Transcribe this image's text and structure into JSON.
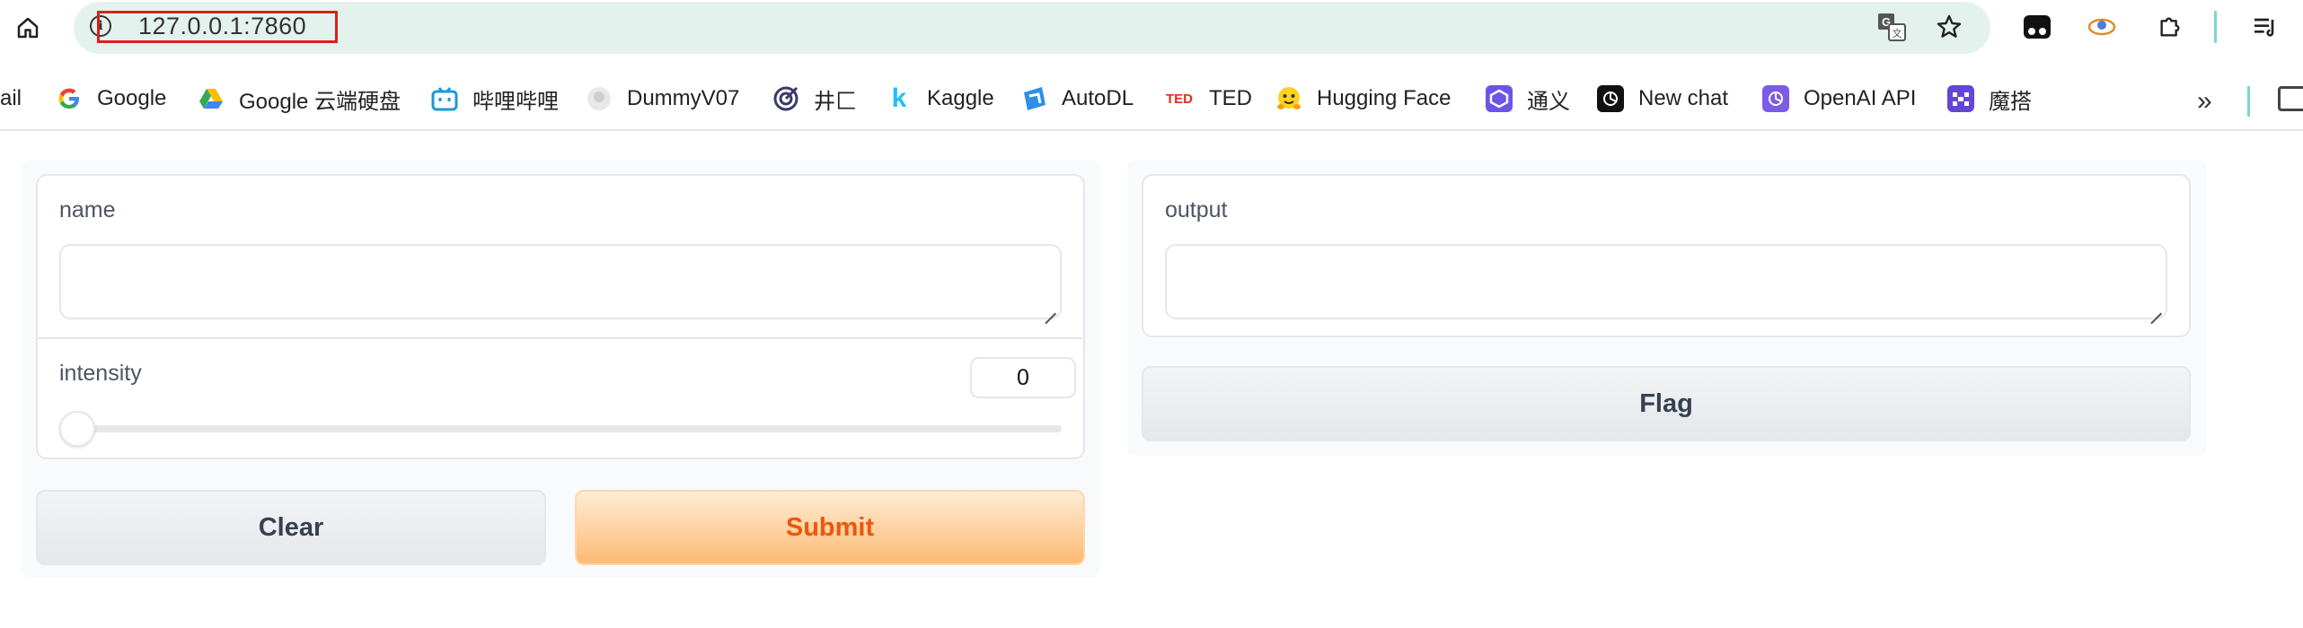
{
  "browser": {
    "url": "127.0.0.1:7860",
    "colors": {
      "omnibox_bg": "#e4f2ee",
      "url_highlight": "#d9201b"
    }
  },
  "bookmarks": [
    {
      "label": "ail",
      "icon": "none"
    },
    {
      "label": "Google",
      "icon": "google-icon"
    },
    {
      "label": "Google 云端硬盘",
      "icon": "google-drive-icon"
    },
    {
      "label": "哔哩哔哩",
      "icon": "bilibili-icon"
    },
    {
      "label": "DummyV07",
      "icon": "github-icon"
    },
    {
      "label": "井匚",
      "icon": "target-icon"
    },
    {
      "label": "Kaggle",
      "icon": "kaggle-icon"
    },
    {
      "label": "AutoDL",
      "icon": "autodl-icon"
    },
    {
      "label": "TED",
      "icon": "ted-icon"
    },
    {
      "label": "Hugging Face",
      "icon": "hugging-face-icon"
    },
    {
      "label": "通义",
      "icon": "tongyi-icon"
    },
    {
      "label": "New chat",
      "icon": "openai-icon"
    },
    {
      "label": "OpenAI API",
      "icon": "openai-api-icon"
    },
    {
      "label": "魔搭",
      "icon": "modelscope-icon"
    }
  ],
  "app": {
    "inputs": {
      "name_label": "name",
      "name_value": "",
      "intensity_label": "intensity",
      "intensity_value": "0",
      "intensity_fraction": 0
    },
    "outputs": {
      "output_label": "output",
      "output_value": ""
    },
    "buttons": {
      "clear": "Clear",
      "submit": "Submit",
      "flag": "Flag"
    },
    "colors": {
      "primary_text": "#ea580c",
      "primary_bg": "#fdba74",
      "secondary_bg": "#e5e7eb"
    }
  }
}
